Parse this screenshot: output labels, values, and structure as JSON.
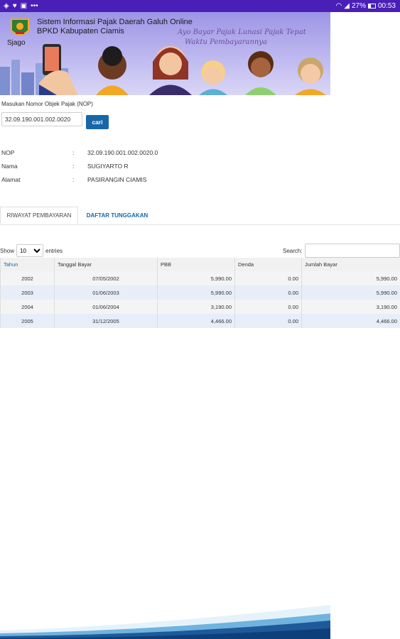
{
  "statusbar": {
    "battery_percent": "27%",
    "time": "00:53",
    "notification_dots": "•••"
  },
  "banner": {
    "title_line1": "Sistem Informasi Pajak Daerah Galuh Online",
    "title_line2": "BPKD Kabupaten Ciamis",
    "app_name": "Sjago",
    "tagline_line1": "Ayo Bayar Pajak Lunasi Pajak Tepat",
    "tagline_line2": "Waktu Pembayarannya"
  },
  "form": {
    "nop_label": "Masukan Nomor Objek Pajak (NOP)",
    "nop_value": "32.09.190.001.002.0020",
    "search_button": "cari"
  },
  "info": {
    "rows": [
      {
        "key": "NOP",
        "sep": ":",
        "value": "32.09.190.001.002.0020.0"
      },
      {
        "key": "Nama",
        "sep": ":",
        "value": "SUGIYARTO R"
      },
      {
        "key": "Alamat",
        "sep": ":",
        "value": "PASIRANGIN CIAMIS"
      }
    ]
  },
  "tabs": {
    "active": "RIWAYAT PEMBAYARAN",
    "other": "DAFTAR TUNGGAKAN"
  },
  "table_controls": {
    "show_label": "Show",
    "entries_value": "10",
    "entries_label": "entries",
    "search_label": "Search:"
  },
  "table": {
    "headers": [
      "Tahun",
      "Tanggal Bayar",
      "PBB",
      "Denda",
      "Jumlah Bayar"
    ],
    "rows": [
      [
        "2002",
        "07/05/2002",
        "5,990.00",
        "0.00",
        "5,990.00"
      ],
      [
        "2003",
        "01/06/2003",
        "5,990.00",
        "0.00",
        "5,990.00"
      ],
      [
        "2004",
        "01/06/2004",
        "3,190.00",
        "0.00",
        "3,190.00"
      ],
      [
        "2005",
        "31/12/2005",
        "4,466.00",
        "0.00",
        "4,466.00"
      ]
    ]
  },
  "colors": {
    "statusbar": "#4a1fb8",
    "accent": "#1767a8"
  }
}
